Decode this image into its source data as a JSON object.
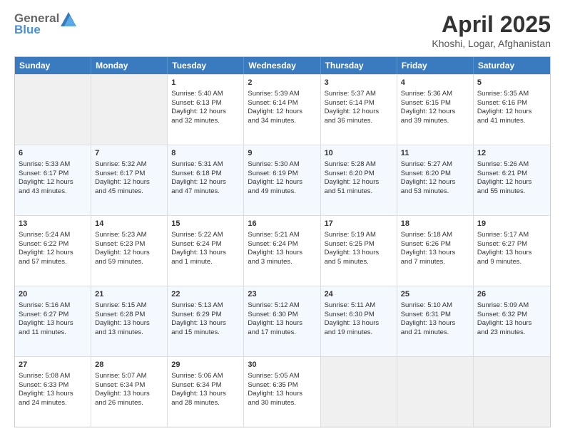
{
  "header": {
    "logo_general": "General",
    "logo_blue": "Blue",
    "title": "April 2025",
    "subtitle": "Khoshi, Logar, Afghanistan"
  },
  "calendar": {
    "days": [
      "Sunday",
      "Monday",
      "Tuesday",
      "Wednesday",
      "Thursday",
      "Friday",
      "Saturday"
    ],
    "weeks": [
      [
        {
          "num": "",
          "lines": []
        },
        {
          "num": "",
          "lines": []
        },
        {
          "num": "1",
          "lines": [
            "Sunrise: 5:40 AM",
            "Sunset: 6:13 PM",
            "Daylight: 12 hours",
            "and 32 minutes."
          ]
        },
        {
          "num": "2",
          "lines": [
            "Sunrise: 5:39 AM",
            "Sunset: 6:14 PM",
            "Daylight: 12 hours",
            "and 34 minutes."
          ]
        },
        {
          "num": "3",
          "lines": [
            "Sunrise: 5:37 AM",
            "Sunset: 6:14 PM",
            "Daylight: 12 hours",
            "and 36 minutes."
          ]
        },
        {
          "num": "4",
          "lines": [
            "Sunrise: 5:36 AM",
            "Sunset: 6:15 PM",
            "Daylight: 12 hours",
            "and 39 minutes."
          ]
        },
        {
          "num": "5",
          "lines": [
            "Sunrise: 5:35 AM",
            "Sunset: 6:16 PM",
            "Daylight: 12 hours",
            "and 41 minutes."
          ]
        }
      ],
      [
        {
          "num": "6",
          "lines": [
            "Sunrise: 5:33 AM",
            "Sunset: 6:17 PM",
            "Daylight: 12 hours",
            "and 43 minutes."
          ]
        },
        {
          "num": "7",
          "lines": [
            "Sunrise: 5:32 AM",
            "Sunset: 6:17 PM",
            "Daylight: 12 hours",
            "and 45 minutes."
          ]
        },
        {
          "num": "8",
          "lines": [
            "Sunrise: 5:31 AM",
            "Sunset: 6:18 PM",
            "Daylight: 12 hours",
            "and 47 minutes."
          ]
        },
        {
          "num": "9",
          "lines": [
            "Sunrise: 5:30 AM",
            "Sunset: 6:19 PM",
            "Daylight: 12 hours",
            "and 49 minutes."
          ]
        },
        {
          "num": "10",
          "lines": [
            "Sunrise: 5:28 AM",
            "Sunset: 6:20 PM",
            "Daylight: 12 hours",
            "and 51 minutes."
          ]
        },
        {
          "num": "11",
          "lines": [
            "Sunrise: 5:27 AM",
            "Sunset: 6:20 PM",
            "Daylight: 12 hours",
            "and 53 minutes."
          ]
        },
        {
          "num": "12",
          "lines": [
            "Sunrise: 5:26 AM",
            "Sunset: 6:21 PM",
            "Daylight: 12 hours",
            "and 55 minutes."
          ]
        }
      ],
      [
        {
          "num": "13",
          "lines": [
            "Sunrise: 5:24 AM",
            "Sunset: 6:22 PM",
            "Daylight: 12 hours",
            "and 57 minutes."
          ]
        },
        {
          "num": "14",
          "lines": [
            "Sunrise: 5:23 AM",
            "Sunset: 6:23 PM",
            "Daylight: 12 hours",
            "and 59 minutes."
          ]
        },
        {
          "num": "15",
          "lines": [
            "Sunrise: 5:22 AM",
            "Sunset: 6:24 PM",
            "Daylight: 13 hours",
            "and 1 minute."
          ]
        },
        {
          "num": "16",
          "lines": [
            "Sunrise: 5:21 AM",
            "Sunset: 6:24 PM",
            "Daylight: 13 hours",
            "and 3 minutes."
          ]
        },
        {
          "num": "17",
          "lines": [
            "Sunrise: 5:19 AM",
            "Sunset: 6:25 PM",
            "Daylight: 13 hours",
            "and 5 minutes."
          ]
        },
        {
          "num": "18",
          "lines": [
            "Sunrise: 5:18 AM",
            "Sunset: 6:26 PM",
            "Daylight: 13 hours",
            "and 7 minutes."
          ]
        },
        {
          "num": "19",
          "lines": [
            "Sunrise: 5:17 AM",
            "Sunset: 6:27 PM",
            "Daylight: 13 hours",
            "and 9 minutes."
          ]
        }
      ],
      [
        {
          "num": "20",
          "lines": [
            "Sunrise: 5:16 AM",
            "Sunset: 6:27 PM",
            "Daylight: 13 hours",
            "and 11 minutes."
          ]
        },
        {
          "num": "21",
          "lines": [
            "Sunrise: 5:15 AM",
            "Sunset: 6:28 PM",
            "Daylight: 13 hours",
            "and 13 minutes."
          ]
        },
        {
          "num": "22",
          "lines": [
            "Sunrise: 5:13 AM",
            "Sunset: 6:29 PM",
            "Daylight: 13 hours",
            "and 15 minutes."
          ]
        },
        {
          "num": "23",
          "lines": [
            "Sunrise: 5:12 AM",
            "Sunset: 6:30 PM",
            "Daylight: 13 hours",
            "and 17 minutes."
          ]
        },
        {
          "num": "24",
          "lines": [
            "Sunrise: 5:11 AM",
            "Sunset: 6:30 PM",
            "Daylight: 13 hours",
            "and 19 minutes."
          ]
        },
        {
          "num": "25",
          "lines": [
            "Sunrise: 5:10 AM",
            "Sunset: 6:31 PM",
            "Daylight: 13 hours",
            "and 21 minutes."
          ]
        },
        {
          "num": "26",
          "lines": [
            "Sunrise: 5:09 AM",
            "Sunset: 6:32 PM",
            "Daylight: 13 hours",
            "and 23 minutes."
          ]
        }
      ],
      [
        {
          "num": "27",
          "lines": [
            "Sunrise: 5:08 AM",
            "Sunset: 6:33 PM",
            "Daylight: 13 hours",
            "and 24 minutes."
          ]
        },
        {
          "num": "28",
          "lines": [
            "Sunrise: 5:07 AM",
            "Sunset: 6:34 PM",
            "Daylight: 13 hours",
            "and 26 minutes."
          ]
        },
        {
          "num": "29",
          "lines": [
            "Sunrise: 5:06 AM",
            "Sunset: 6:34 PM",
            "Daylight: 13 hours",
            "and 28 minutes."
          ]
        },
        {
          "num": "30",
          "lines": [
            "Sunrise: 5:05 AM",
            "Sunset: 6:35 PM",
            "Daylight: 13 hours",
            "and 30 minutes."
          ]
        },
        {
          "num": "",
          "lines": []
        },
        {
          "num": "",
          "lines": []
        },
        {
          "num": "",
          "lines": []
        }
      ]
    ]
  }
}
